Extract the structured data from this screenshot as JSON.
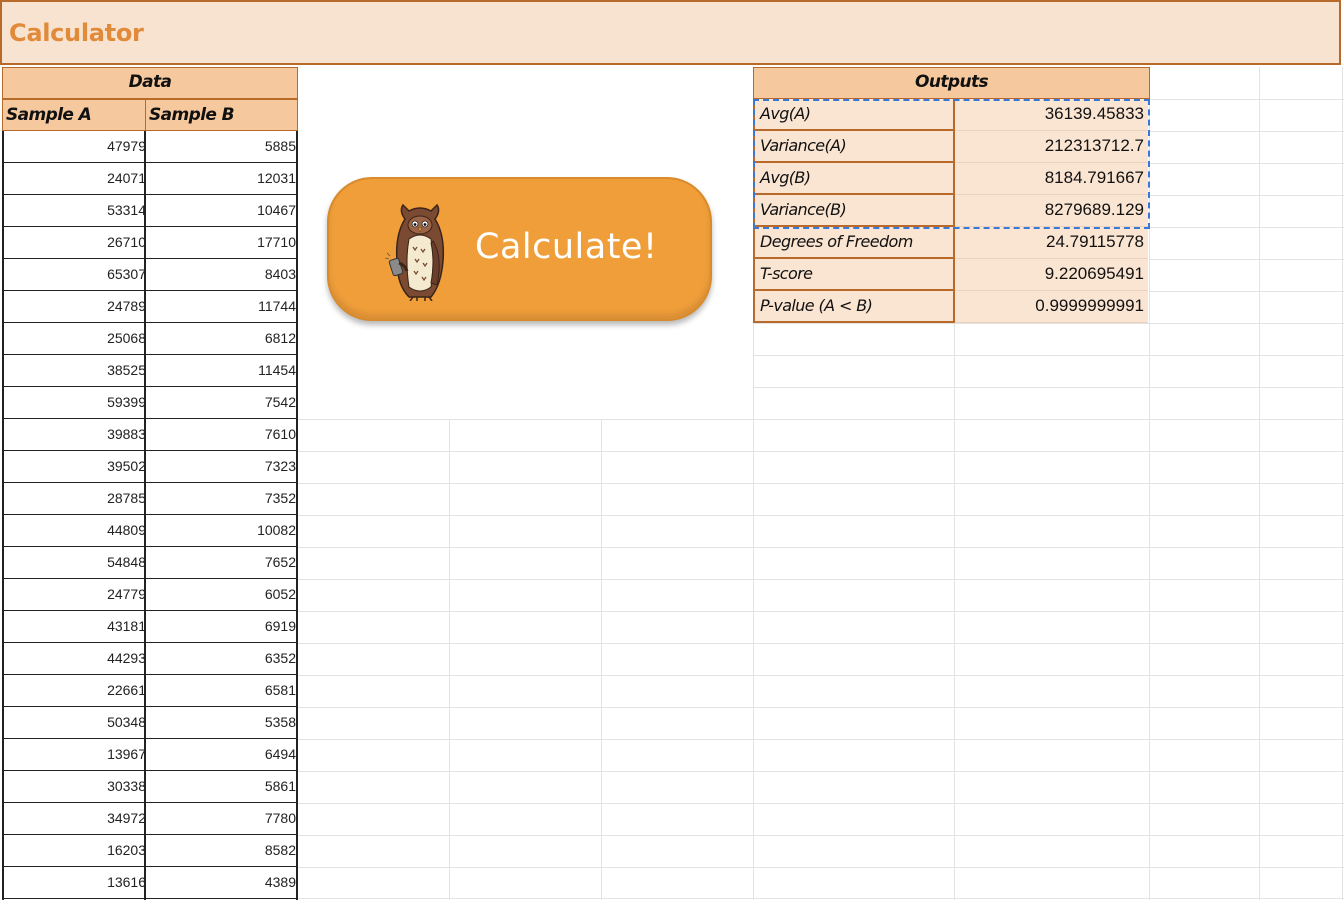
{
  "title": "Calculator",
  "data_table": {
    "header": "Data",
    "col_a": "Sample A",
    "col_b": "Sample B",
    "rows": [
      [
        "47979",
        "5885"
      ],
      [
        "24071",
        "12031"
      ],
      [
        "53314",
        "10467"
      ],
      [
        "26710",
        "17710"
      ],
      [
        "65307",
        "8403"
      ],
      [
        "24789",
        "11744"
      ],
      [
        "25068",
        "6812"
      ],
      [
        "38525",
        "11454"
      ],
      [
        "59399",
        "7542"
      ],
      [
        "39883",
        "7610"
      ],
      [
        "39502",
        "7323"
      ],
      [
        "28785",
        "7352"
      ],
      [
        "44809",
        "10082"
      ],
      [
        "54848",
        "7652"
      ],
      [
        "24779",
        "6052"
      ],
      [
        "43181",
        "6919"
      ],
      [
        "44293",
        "6352"
      ],
      [
        "22661",
        "6581"
      ],
      [
        "50348",
        "5358"
      ],
      [
        "13967",
        "6494"
      ],
      [
        "30338",
        "5861"
      ],
      [
        "34972",
        "7780"
      ],
      [
        "16203",
        "8582"
      ],
      [
        "13616",
        "4389"
      ]
    ]
  },
  "button": {
    "label": "Calculate!",
    "icon": "owl-holding-phone-icon"
  },
  "outputs": {
    "header": "Outputs",
    "rows": [
      {
        "label": "Avg(A)",
        "value": "36139.45833"
      },
      {
        "label": "Variance(A)",
        "value": "212313712.7"
      },
      {
        "label": "Avg(B)",
        "value": "8184.791667"
      },
      {
        "label": "Variance(B)",
        "value": "8279689.129"
      },
      {
        "label": "Degrees of Freedom",
        "value": "24.79115778"
      },
      {
        "label": "T-score",
        "value": "9.220695491"
      },
      {
        "label": "P-value (A < B)",
        "value": "0.9999999991"
      }
    ]
  },
  "colors": {
    "title_bg": "#f7e3d0",
    "title_text": "#e08a3a",
    "header_bg": "#f5c89d",
    "output_bg": "#fae4d2",
    "border": "#b86a2a",
    "button": "#f09e3a",
    "selection": "#3a78d8"
  }
}
